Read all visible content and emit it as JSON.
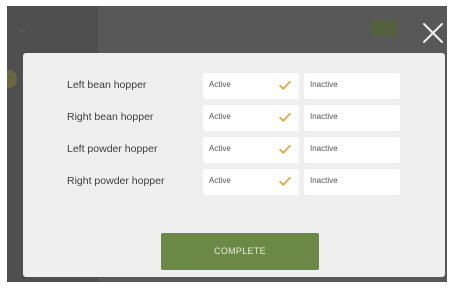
{
  "background": {
    "left_panel_label": "—"
  },
  "modal": {
    "rows": [
      {
        "label": "Left bean hopper",
        "active_label": "Active",
        "inactive_label": "Inactive",
        "selected": "Active"
      },
      {
        "label": "Right bean hopper",
        "active_label": "Active",
        "inactive_label": "Inactive",
        "selected": "Active"
      },
      {
        "label": "Left powder hopper",
        "active_label": "Active",
        "inactive_label": "Inactive",
        "selected": "Active"
      },
      {
        "label": "Right powder hopper",
        "active_label": "Active",
        "inactive_label": "Inactive",
        "selected": "Active"
      }
    ],
    "complete_label": "COMPLETE"
  },
  "colors": {
    "accent_green": "#6b8846",
    "check_orange": "#e8a24a",
    "modal_background": "#efefef",
    "overlay_background": "#585858"
  },
  "icons": {
    "close": "close-icon",
    "check": "check-icon"
  }
}
